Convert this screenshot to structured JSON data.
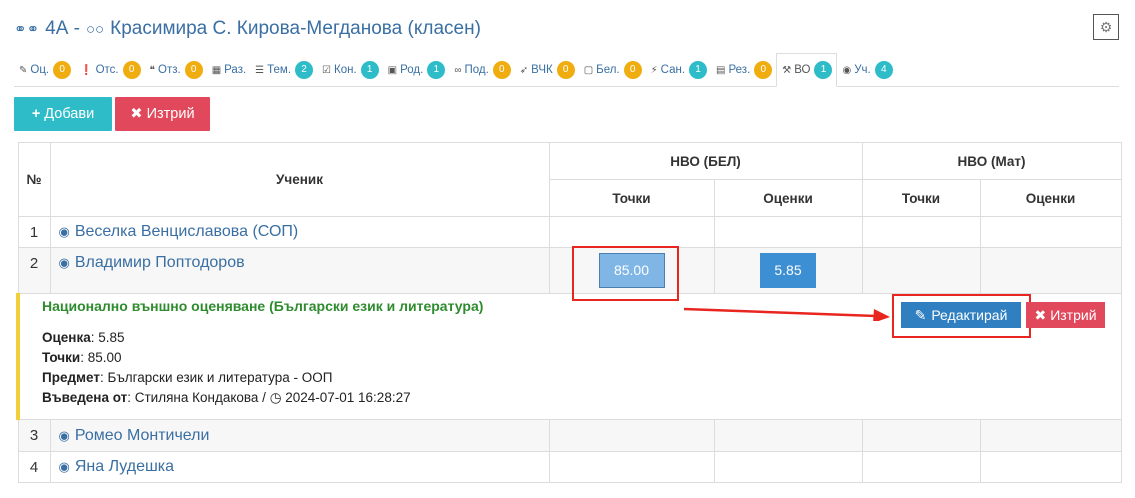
{
  "header": {
    "group_icon": "group-icon",
    "title_prefix": "4А -",
    "teacher_icon": "glasses-icon",
    "title": "Красимира С. Кирова-Мегданова (класен)"
  },
  "tabs": [
    {
      "label": "Оц.",
      "badge": "0",
      "icon": "pencil-icon",
      "color": "#f0ad10"
    },
    {
      "label": "Отс.",
      "badge": "0",
      "icon": "exclamation-icon",
      "color": "#f0ad10"
    },
    {
      "label": "Отз.",
      "badge": "0",
      "icon": "speech-icon",
      "color": "#f0ad10"
    },
    {
      "label": "Раз.",
      "badge": "",
      "icon": "table-icon",
      "color": ""
    },
    {
      "label": "Тем.",
      "badge": "2",
      "icon": "list-icon",
      "color": "#2ebcc9"
    },
    {
      "label": "Кон.",
      "badge": "1",
      "icon": "check-icon",
      "color": "#2ebcc9"
    },
    {
      "label": "Род.",
      "badge": "1",
      "icon": "calendar-icon",
      "color": "#2ebcc9"
    },
    {
      "label": "Под.",
      "badge": "0",
      "icon": "handshake-icon",
      "color": "#f0ad10"
    },
    {
      "label": "ВЧК",
      "badge": "0",
      "icon": "rocket-icon",
      "color": "#f0ad10"
    },
    {
      "label": "Бел.",
      "badge": "0",
      "icon": "note-icon",
      "color": "#f0ad10"
    },
    {
      "label": "Сан.",
      "badge": "1",
      "icon": "bolt-icon",
      "color": "#2ebcc9"
    },
    {
      "label": "Рез.",
      "badge": "0",
      "icon": "document-icon",
      "color": "#f0ad10"
    },
    {
      "label": "ВО",
      "badge": "1",
      "icon": "gavel-icon",
      "color": "#2ebcc9"
    },
    {
      "label": "Уч.",
      "badge": "4",
      "icon": "student-icon",
      "color": "#2ebcc9"
    }
  ],
  "toolbar": {
    "add_label": "Добави",
    "delete_label": "Изтрий"
  },
  "table": {
    "col_num": "№",
    "col_student": "Ученик",
    "group1": "НВО (БЕЛ)",
    "group2": "НВО (Мат)",
    "points": "Точки",
    "grades": "Оценки",
    "rows": [
      {
        "num": "1",
        "name": "Веселка Венциславова (СОП)"
      },
      {
        "num": "2",
        "name": "Владимир Поптодоров",
        "bel_points": "85.00",
        "bel_grade": "5.85"
      },
      {
        "num": "3",
        "name": "Ромео Монтичели"
      },
      {
        "num": "4",
        "name": "Яна Лудешка"
      }
    ]
  },
  "detail": {
    "title": "Национално външно оценяване (Български език и литература)",
    "grade_label": "Оценка",
    "grade_value": ": 5.85",
    "points_label": "Точки",
    "points_value": ": 85.00",
    "subject_label": "Предмет",
    "subject_value": ": Български език и литература - ООП",
    "entered_label": "Въведена от",
    "entered_value": ": Стиляна Кондакова /",
    "timestamp": "2024-07-01 16:28:27",
    "edit_label": "Редактирай",
    "delete_label": "Изтрий"
  },
  "colors": {
    "accent": "#3a6fa3",
    "teal": "#2ebcc9",
    "danger": "#e2485b",
    "highlight": "#e8261f"
  }
}
